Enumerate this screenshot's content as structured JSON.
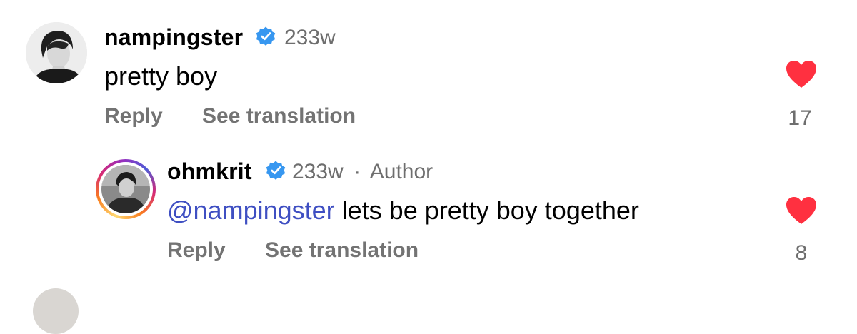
{
  "comments": [
    {
      "username": "nampingster",
      "time": "233w",
      "text": "pretty boy",
      "reply_label": "Reply",
      "translate_label": "See translation",
      "likes": "17",
      "verified_icon": "verified-badge-icon",
      "like_icon": "heart-filled-icon"
    },
    {
      "username": "ohmkrit",
      "time": "233w",
      "separator": "·",
      "author_label": "Author",
      "mention": "@nampingster",
      "text": " lets be pretty boy together",
      "reply_label": "Reply",
      "translate_label": "See translation",
      "likes": "8",
      "verified_icon": "verified-badge-icon",
      "like_icon": "heart-filled-icon"
    }
  ],
  "colors": {
    "verified": "#3797f0",
    "heart": "#ff3040",
    "mention": "#3f4fc2",
    "secondary_text": "#737373"
  }
}
